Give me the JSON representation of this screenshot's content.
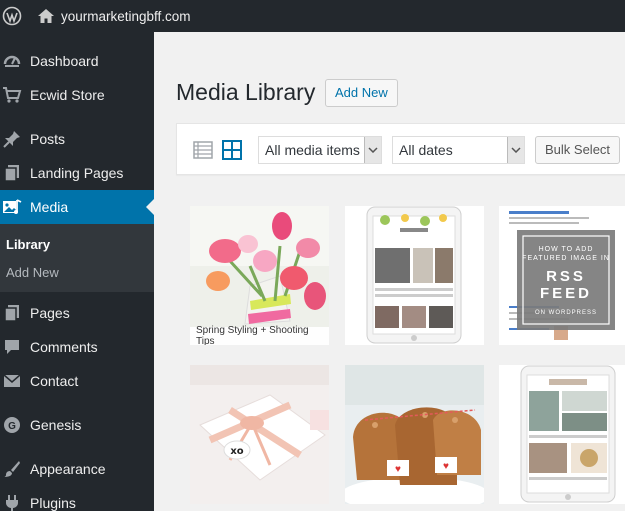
{
  "adminbar": {
    "site_name": "yourmarketingbff.com"
  },
  "sidebar": {
    "items": [
      {
        "label": "Dashboard",
        "icon": "dashboard-icon"
      },
      {
        "label": "Ecwid Store",
        "icon": "cart-icon"
      },
      {
        "label": "Posts",
        "icon": "pushpin-icon"
      },
      {
        "label": "Landing Pages",
        "icon": "page-icon"
      },
      {
        "label": "Media",
        "icon": "media-icon",
        "current": true
      },
      {
        "label": "Pages",
        "icon": "pages-icon"
      },
      {
        "label": "Comments",
        "icon": "comment-icon"
      },
      {
        "label": "Contact",
        "icon": "envelope-icon"
      },
      {
        "label": "Genesis",
        "icon": "genesis-icon"
      },
      {
        "label": "Appearance",
        "icon": "paintbrush-icon"
      },
      {
        "label": "Plugins",
        "icon": "plugin-icon"
      }
    ],
    "media_submenu": [
      {
        "label": "Library",
        "current": true
      },
      {
        "label": "Add New"
      }
    ]
  },
  "main": {
    "title": "Media Library",
    "add_new_label": "Add New",
    "toolbar": {
      "type_filter": "All media items",
      "date_filter": "All dates",
      "bulk_select_label": "Bulk Select"
    },
    "thumbnails": [
      {
        "caption": "Spring Styling + Shooting Tips"
      },
      {
        "caption": ""
      },
      {
        "overlay_lines": [
          "HOW TO ADD",
          "FEATURED IMAGE IN",
          "RSS",
          "FEED",
          "ON WORDPRESS"
        ]
      },
      {
        "caption": ""
      },
      {
        "caption": ""
      },
      {
        "caption": ""
      }
    ]
  },
  "colors": {
    "admin_bg": "#23282d",
    "accent": "#0073aa",
    "submenu_bg": "#32373c",
    "body_bg": "#f1f1f1"
  }
}
